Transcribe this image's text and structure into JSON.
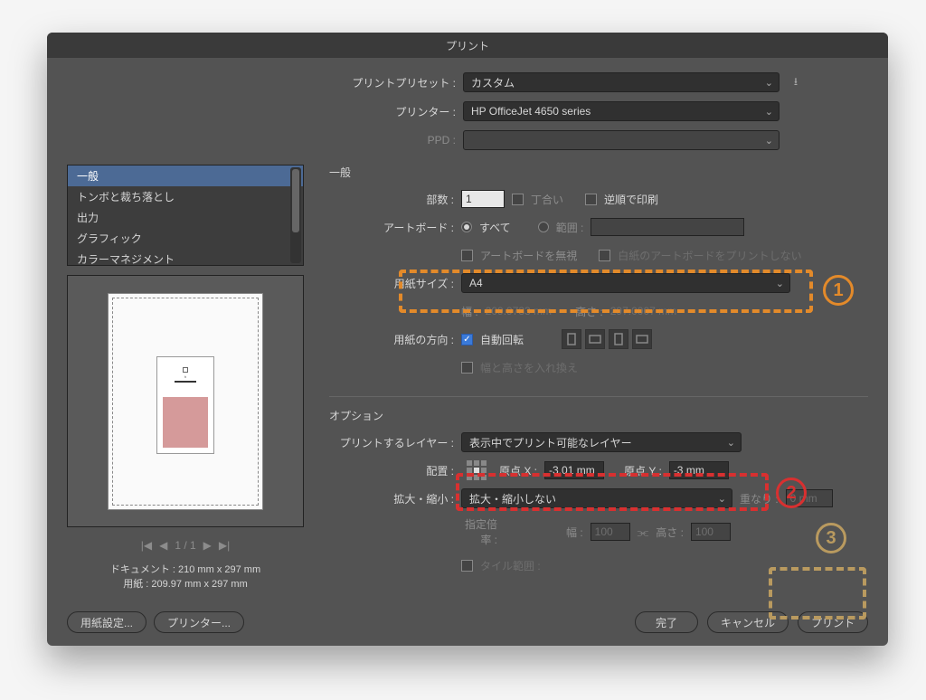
{
  "title": "プリント",
  "top": {
    "preset_label": "プリントプリセット :",
    "preset_value": "カスタム",
    "printer_label": "プリンター :",
    "printer_value": "HP OfficeJet 4650 series",
    "ppd_label": "PPD :",
    "ppd_value": ""
  },
  "categories": [
    "一般",
    "トンボと裁ち落とし",
    "出力",
    "グラフィック",
    "カラーマネジメント"
  ],
  "pager": {
    "first": "|◀",
    "prev": "◀",
    "pos": "1 / 1",
    "next": "▶",
    "last": "▶|"
  },
  "dims": {
    "doc": "ドキュメント : 210 mm x 297 mm",
    "paper": "用紙 : 209.97 mm x 297 mm"
  },
  "left_buttons": {
    "page_setup": "用紙設定...",
    "printer": "プリンター..."
  },
  "general": {
    "title": "一般",
    "copies_label": "部数 :",
    "copies_value": "1",
    "collate": "丁合い",
    "reverse": "逆順で印刷",
    "artboard_label": "アートボード :",
    "all": "すべて",
    "range": "範囲 :",
    "range_value": "",
    "ignore_ab": "アートボードを無視",
    "skip_blank": "白紙のアートボードをプリントしない",
    "size_label": "用紙サイズ :",
    "size_value": "A4",
    "w_label": "幅 :",
    "w_value": "209.9733 mm",
    "h_label": "高さ :",
    "h_value": "297.0007 mm",
    "orient_label": "用紙の方向 :",
    "auto_rotate": "自動回転",
    "swap": "幅と高さを入れ換え"
  },
  "options": {
    "title": "オプション",
    "layers_label": "プリントするレイヤー :",
    "layers_value": "表示中でプリント可能なレイヤー",
    "placement_label": "配置 :",
    "ox_label": "原点 X :",
    "ox_value": "-3.01 mm",
    "oy_label": "原点 Y :",
    "oy_value": "-3 mm",
    "scale_label": "拡大・縮小 :",
    "scale_value": "拡大・縮小しない",
    "overlap_label": "重なり :",
    "overlap_value": "0 mm",
    "ratio_label": "指定倍率 :",
    "rw_label": "幅 :",
    "rw_value": "100",
    "rh_label": "高さ :",
    "rh_value": "100",
    "tile": "タイル範囲 :"
  },
  "buttons": {
    "done": "完了",
    "cancel": "キャンセル",
    "print": "プリント"
  },
  "annot": {
    "n1": "1",
    "n2": "2",
    "n3": "3"
  }
}
